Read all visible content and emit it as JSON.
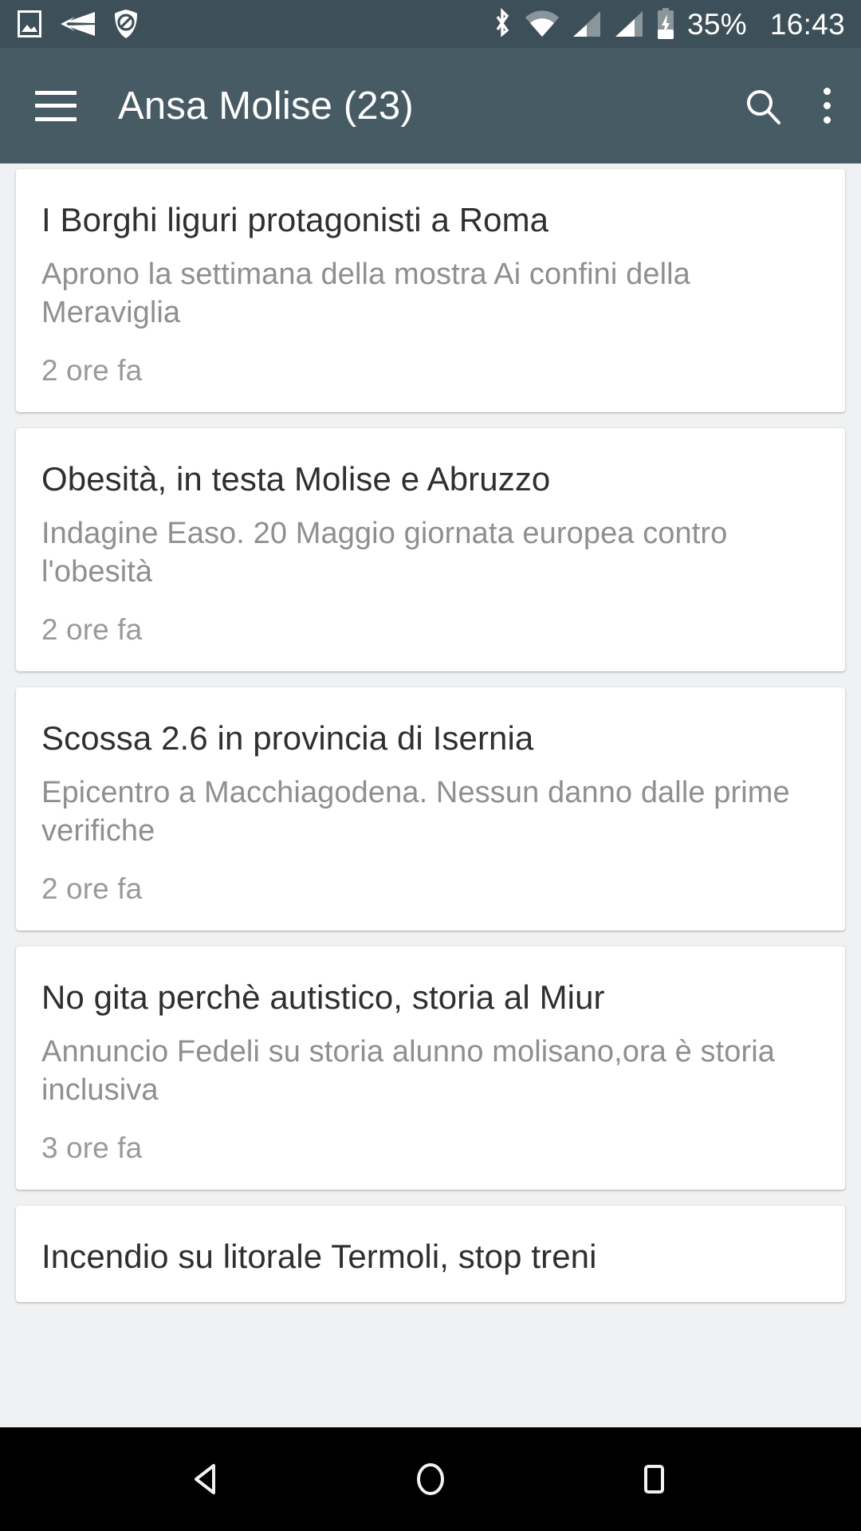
{
  "status_bar": {
    "background": "#3d4f58",
    "left_icons": [
      {
        "name": "image-icon",
        "label": "screenshot"
      },
      {
        "name": "send-icon",
        "label": "data-transfer"
      },
      {
        "name": "shield-block-icon",
        "label": "blocked"
      }
    ],
    "right_icons": [
      {
        "name": "bluetooth-icon",
        "label": "bluetooth"
      },
      {
        "name": "wifi-icon",
        "label": "wifi"
      },
      {
        "name": "signal-sim1-icon",
        "label": "signal-1"
      },
      {
        "name": "signal-sim2-icon",
        "label": "signal-2"
      },
      {
        "name": "battery-charging-icon",
        "label": "battery-charging"
      }
    ],
    "battery_percent": "35%",
    "clock": "16:43"
  },
  "app_bar": {
    "background": "#475b65",
    "menu_icon": "hamburger-icon",
    "title": "Ansa Molise (23)",
    "search_icon": "search-icon",
    "overflow_icon": "overflow-menu-icon"
  },
  "articles": [
    {
      "title": "I Borghi liguri protagonisti a Roma",
      "description": "Aprono la settimana della mostra Ai confini della Meraviglia",
      "time": "2 ore fa"
    },
    {
      "title": "Obesità, in testa Molise e Abruzzo",
      "description": "Indagine Easo. 20 Maggio giornata europea contro l'obesità",
      "time": "2 ore fa"
    },
    {
      "title": "Scossa 2.6 in provincia di Isernia",
      "description": "Epicentro a Macchiagodena. Nessun danno dalle prime verifiche",
      "time": "2 ore fa"
    },
    {
      "title": "No gita perchè autistico, storia al Miur",
      "description": "Annuncio Fedeli su storia alunno molisano,ora è storia inclusiva",
      "time": "3 ore fa"
    },
    {
      "title": "Incendio su litorale Termoli, stop treni",
      "description": "",
      "time": ""
    }
  ],
  "nav_bar": {
    "background": "#000000",
    "back_label": "back-button",
    "home_label": "home-button",
    "recents_label": "recents-button"
  }
}
